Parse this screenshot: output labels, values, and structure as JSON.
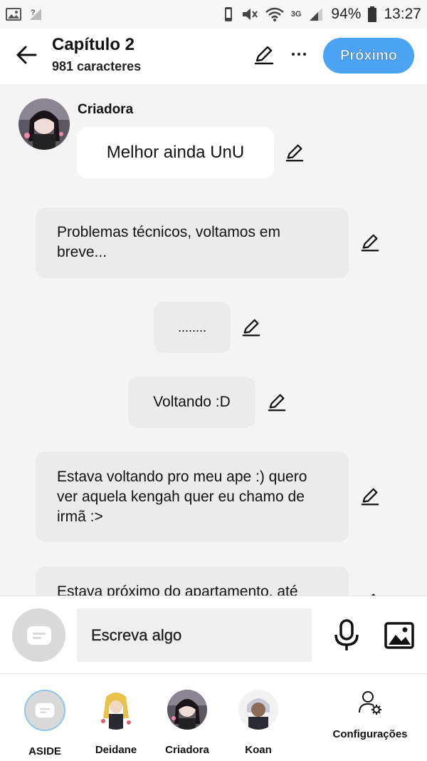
{
  "status_bar": {
    "network": "3G",
    "battery": "94%",
    "time": "13:27"
  },
  "header": {
    "title": "Capítulo 2",
    "subtitle": "981 caracteres",
    "next_label": "Próximo",
    "accent": "#4aa3f5"
  },
  "chat": {
    "author": "Criadora",
    "messages": [
      {
        "text": "Melhor ainda UnU",
        "style": "white"
      },
      {
        "text": "Problemas técnicos, voltamos em breve...",
        "style": "grey"
      },
      {
        "text": "........",
        "style": "grey"
      },
      {
        "text": "Voltando :D",
        "style": "grey"
      },
      {
        "text": "Estava voltando pro meu ape :) quero ver aquela kengah quer eu chamo de irmã :>",
        "style": "grey"
      },
      {
        "text": "Estava próximo do apartamento, até",
        "style": "grey"
      }
    ]
  },
  "input": {
    "placeholder": "Escreva algo"
  },
  "characters": [
    {
      "name": "ASIDE"
    },
    {
      "name": "Deidane"
    },
    {
      "name": "Criadora"
    },
    {
      "name": "Koan"
    }
  ],
  "settings_label": "Configurações",
  "icons": [
    "image-icon",
    "signal-question-icon",
    "vibrate-icon",
    "mute-icon",
    "wifi-icon",
    "signal-icon",
    "battery-icon",
    "back-arrow-icon",
    "pencil-icon",
    "more-icon",
    "chat-bubble-icon",
    "mic-icon",
    "gallery-icon",
    "settings-user-icon"
  ]
}
